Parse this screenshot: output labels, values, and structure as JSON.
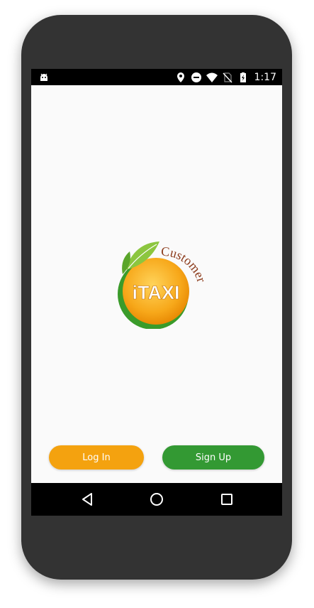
{
  "status_bar": {
    "time": "1:17",
    "icons": [
      "android-debug-icon",
      "location-pin-icon",
      "do-not-disturb-icon",
      "wifi-icon",
      "no-sim-icon",
      "battery-charging-icon"
    ]
  },
  "logo": {
    "brand": "iTAXI",
    "tagline": "Customer",
    "colors": {
      "orange": "#f4a20f",
      "green": "#339933",
      "leaf": "#8cc63f",
      "tagline": "#8b3a1a"
    }
  },
  "buttons": {
    "login_label": "Log In",
    "signup_label": "Sign Up"
  },
  "nav_bar": {
    "icons": [
      "back-icon",
      "home-icon",
      "recents-icon"
    ]
  }
}
